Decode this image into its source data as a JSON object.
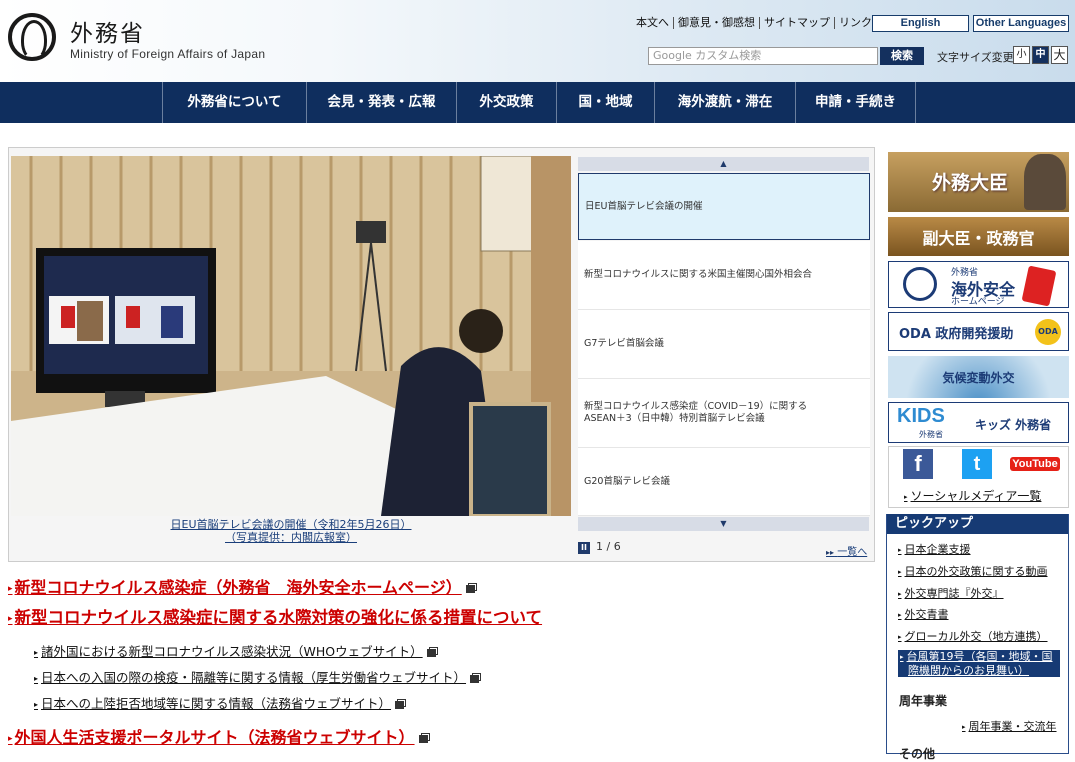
{
  "header": {
    "logo_jp": "外務省",
    "logo_en": "Ministry of Foreign Affairs of Japan",
    "util_links": [
      "本文へ",
      "御意見・御感想",
      "サイトマップ",
      "リンク集"
    ],
    "english": "English",
    "other_languages": "Other Languages",
    "search_placeholder": "Google カスタム検索",
    "search_button": "検索",
    "font_size_label": "文字サイズ変更",
    "font_sizes": [
      "小",
      "中",
      "大"
    ]
  },
  "nav": [
    "外務省について",
    "会見・発表・広報",
    "外交政策",
    "国・地域",
    "海外渡航・滞在",
    "申請・手続き"
  ],
  "slider": {
    "caption_line1": "日EU首脳テレビ会議の開催（令和2年5月26日）",
    "caption_line2": "（写真提供：内閣広報室）",
    "up_arrow": "▲",
    "down_arrow": "▼",
    "items": [
      "日EU首脳テレビ会議の開催",
      "新型コロナウイルスに関する米国主催関心国外相会合",
      "G7テレビ首脳会議",
      "新型コロナウイルス感染症（COVID－19）に関する",
      "ASEAN＋3（日中韓）特別首脳テレビ会議",
      "G20首脳テレビ会議"
    ],
    "pause": "II",
    "pager": "1 / 6",
    "list_all": "一覧へ",
    "list_arrow": "▸▸"
  },
  "main_links": [
    "新型コロナウイルス感染症（外務省　海外安全ホームページ）",
    "新型コロナウイルス感染症に関する水際対策の強化に係る措置について",
    "外国人生活支援ポータルサイト（法務省ウェブサイト）"
  ],
  "sub_links": [
    "諸外国における新型コロナウイルス感染状況（WHOウェブサイト）",
    "日本への入国の際の検疫・隔離等に関する情報（厚生労働省ウェブサイト）",
    "日本への上陸拒否地域等に関する情報（法務省ウェブサイト）"
  ],
  "sidebar": {
    "minister": "外務大臣",
    "vice": "副大臣・政務官",
    "safety_small": "外務省",
    "safety_big": "海外安全",
    "safety_sub": "ホームページ",
    "oda": "ODA 政府開発援助",
    "oda_badge": "ODA",
    "climate": "気候変動外交",
    "kids_logo": "KIDS",
    "kids_sub": "外務省",
    "kids": "キッズ 外務省",
    "sns_f": "f",
    "sns_t": "t",
    "sns_y": "YouTube",
    "social": "ソーシャルメディア一覧",
    "pickup_title": "ピックアップ",
    "pickup": [
      "日本企業支援",
      "日本の外交政策に関する動画",
      "外交専門誌『外交』",
      "外交青書",
      "グローカル外交（地方連携）"
    ],
    "typhoon_line1": "台風第19号（各国・地域・国",
    "typhoon_line2": "際機関からのお見舞い）",
    "anniv_title": "周年事業",
    "anniv_link": "周年事業・交流年",
    "other": "その他"
  },
  "colors": {
    "navy": "#0f2e5e",
    "red_link": "#cc0000",
    "pickup_blue": "#163a74"
  }
}
